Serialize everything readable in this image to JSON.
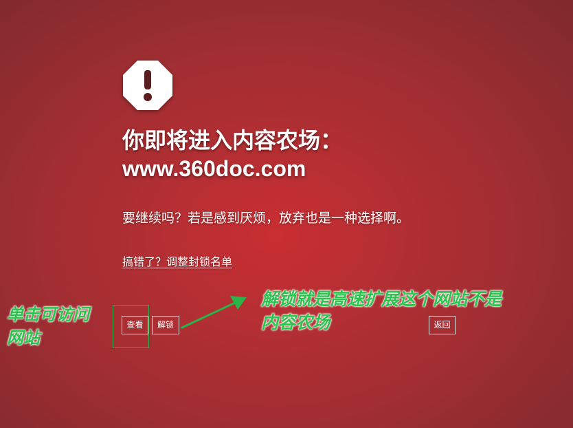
{
  "icon": "octagon-exclamation-icon",
  "title": {
    "line1": "你即将进入内容农场：",
    "line2": "www.360doc.com"
  },
  "message": "要继续吗？若是感到厌烦，放弃也是一种选择啊。",
  "adjust_link": "搞错了？调整封锁名单",
  "buttons": {
    "view": "查看",
    "unlock": "解锁",
    "back": "返回"
  },
  "annotations": {
    "left_line1": "单击可访问",
    "left_line2": "网站",
    "right_line1": "解锁就是高速扩展这个网站不是",
    "right_line2": "内容农场"
  },
  "colors": {
    "background": "#b22f33",
    "annotation": "#2bc44e",
    "icon_mark": "#8a2a2e"
  }
}
